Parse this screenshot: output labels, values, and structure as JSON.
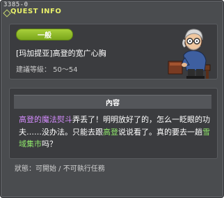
{
  "window": {
    "quest_id": "3385-0",
    "title": "QUEST INFO"
  },
  "header": {
    "category": "一般",
    "quest_name": "[玛加提亚]高登的宽广心胸",
    "level_text": "建議等級： 50～54",
    "npc_icon": "npc-old-man-with-goggles-icon"
  },
  "content": {
    "header": "內容",
    "segments": {
      "s1": "高登的魔法熨斗",
      "s2": "弄丢了！明明放好了的，怎么一眨眼的功夫……没办法。只能去跟",
      "s3": "高登",
      "s4": "说说看了。真的要去一趟",
      "s5": "雪域集市",
      "s6": "吗？"
    }
  },
  "status": {
    "text": "狀態：可開始 / 不可執行任務"
  },
  "colors": {
    "window_bg": "#4a4c4f",
    "panel_bg": "#3b3c3f",
    "title": "#e8f06a",
    "badge": "#8fbf2a",
    "highlight_item": "#d58cff",
    "highlight_place": "#8fe86b"
  }
}
